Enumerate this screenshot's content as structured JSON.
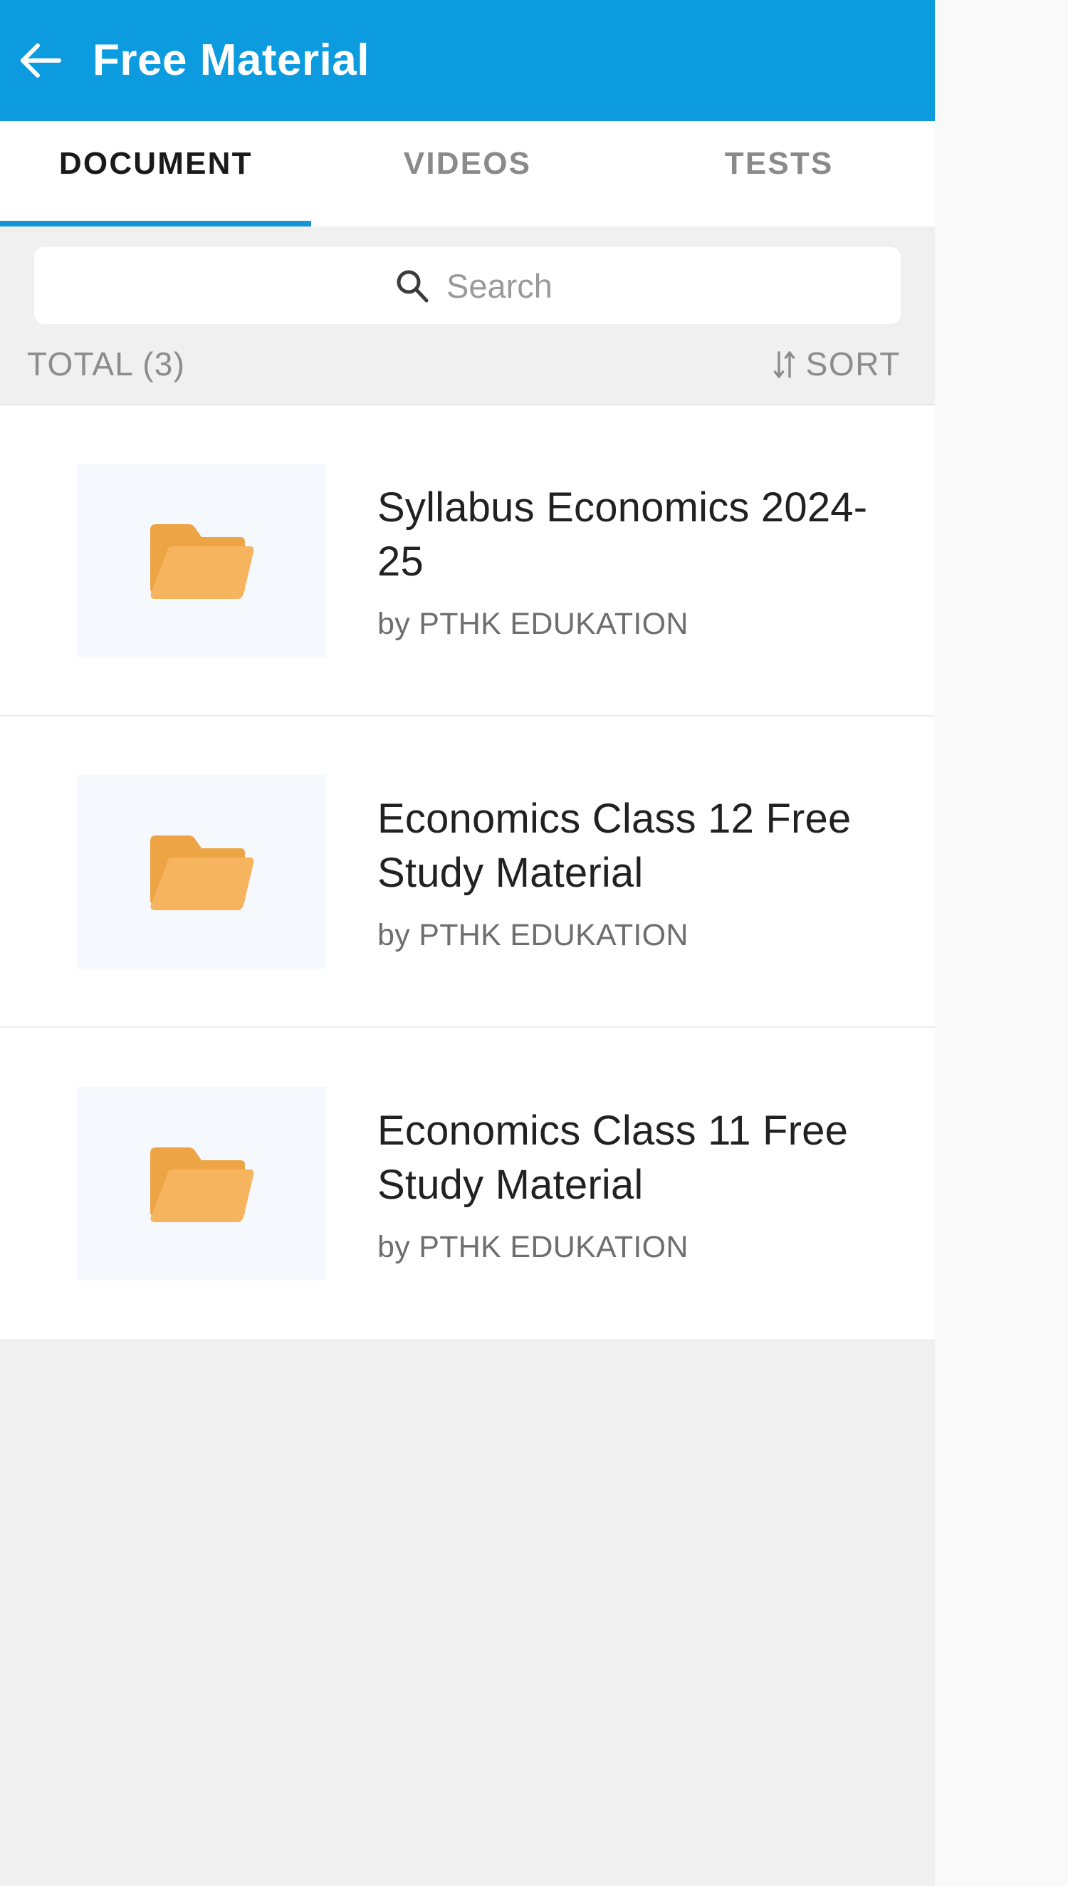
{
  "theme": {
    "app_bar_color": "#0C9BDE",
    "tab_indicator_color": "#1596D8",
    "active_tab_color": "#1A1A1A",
    "inactive_tab_color": "#8A8A8A",
    "page_background": "#F0F0F0",
    "card_background": "#FFFFFF",
    "thumb_background": "#F5F8FC",
    "folder_back_color": "#EDA445",
    "folder_front_color": "#F6B45F",
    "muted_text_color": "#8C8C8C",
    "title_text_color": "#212121",
    "author_text_color": "#6E6E6E",
    "outer_gutter_color": "#F9F9F9"
  },
  "app_bar": {
    "back_icon": "arrow-left-icon",
    "title": "Free Material"
  },
  "tabs": [
    {
      "label": "DOCUMENT",
      "active": true
    },
    {
      "label": "VIDEOS",
      "active": false
    },
    {
      "label": "TESTS",
      "active": false
    }
  ],
  "search": {
    "icon": "search-icon",
    "placeholder": "Search",
    "value": ""
  },
  "meta_row": {
    "total_label": "TOTAL (3)",
    "total_count": 3,
    "sort_icon": "sort-arrows-icon",
    "sort_label": "SORT"
  },
  "documents": [
    {
      "icon": "folder-icon",
      "title": "Syllabus Economics 2024-25",
      "author": "by PTHK EDUKATION"
    },
    {
      "icon": "folder-icon",
      "title": "Economics Class 12 Free Study Material",
      "author": "by PTHK EDUKATION"
    },
    {
      "icon": "folder-icon",
      "title": "Economics Class 11 Free Study Material",
      "author": "by PTHK EDUKATION"
    }
  ]
}
